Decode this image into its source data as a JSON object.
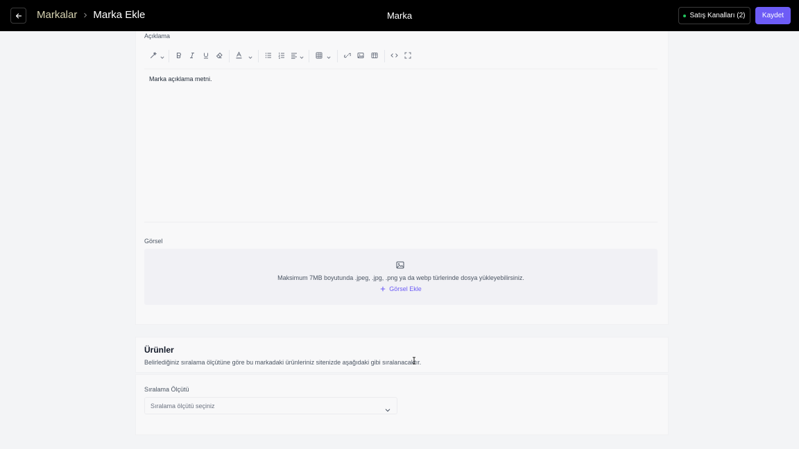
{
  "header": {
    "breadcrumb_parent": "Markalar",
    "breadcrumb_current": "Marka Ekle",
    "title": "Marka",
    "channels_label": "Satış Kanalları (2)",
    "save_label": "Kaydet",
    "channels_status_color": "#22c55e",
    "accent_color": "#6d5cf6"
  },
  "description": {
    "label": "Açıklama",
    "toolbar": [
      "magic-wand-icon",
      "bold-icon",
      "italic-icon",
      "underline-icon",
      "eraser-icon",
      "text-color-icon",
      "bullet-list-icon",
      "numbered-list-icon",
      "align-icon",
      "table-icon",
      "link-icon",
      "image-icon",
      "video-icon",
      "code-icon",
      "fullscreen-icon"
    ],
    "content": "Marka açıklama metni."
  },
  "image": {
    "label": "Görsel",
    "note": "Maksimum 7MB boyutunda .jpeg, .jpg, .png ya da webp türlerinde dosya yükleyebilirsiniz.",
    "add_label": "Görsel Ekle"
  },
  "products": {
    "title": "Ürünler",
    "description": "Belirlediğiniz sıralama ölçütüne göre bu markadaki ürünleriniz sitenizde aşağıdaki gibi sıralanacaktır.",
    "sort_label": "Sıralama Ölçütü",
    "sort_placeholder": "Sıralama ölçütü seçiniz"
  }
}
